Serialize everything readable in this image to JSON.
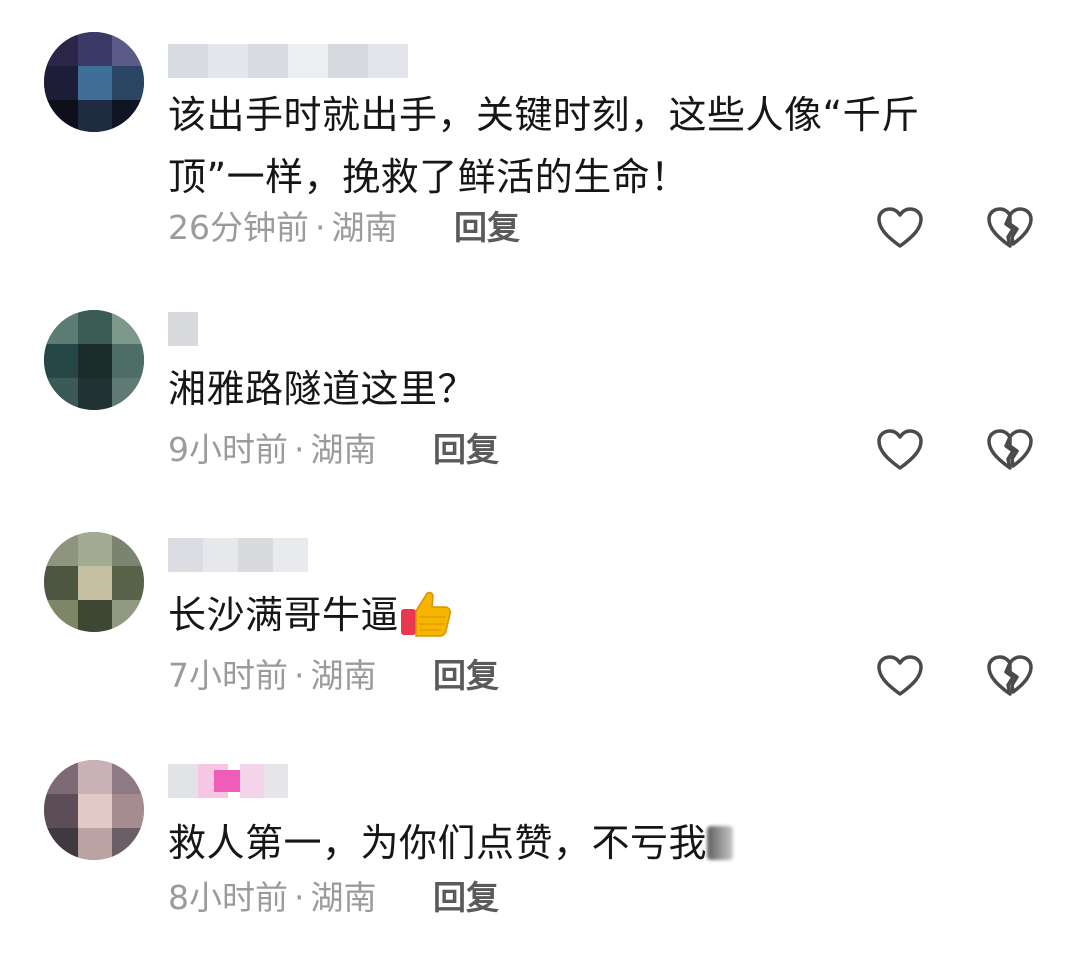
{
  "comments": [
    {
      "text_line1": "该出手时就出手，关键时刻，这些人像“千斤",
      "text_line2": "顶”一样，挽救了鲜活的生命！",
      "time": "26分钟前",
      "location": "湖南",
      "separator": "·",
      "reply_label": "回复"
    },
    {
      "text_line1": "湘雅路隧道这里？",
      "time": "9小时前",
      "location": "湖南",
      "separator": "·",
      "reply_label": "回复"
    },
    {
      "text_line1": "长沙满哥牛逼",
      "emoji": "thumbs-up-icon",
      "time": "7小时前",
      "location": "湖南",
      "separator": "·",
      "reply_label": "回复"
    },
    {
      "text_line1": "救人第一，为你们点赞，不亏我",
      "time": "8小时前",
      "location": "湖南",
      "separator": "·",
      "reply_label": "回复"
    }
  ],
  "icons": {
    "like": "heart-outline-icon",
    "dislike": "broken-heart-icon"
  },
  "colors": {
    "text": "#161616",
    "meta": "#9b9b9b",
    "reply": "#5a5a5a",
    "icon_stroke": "#4a4a4a"
  }
}
